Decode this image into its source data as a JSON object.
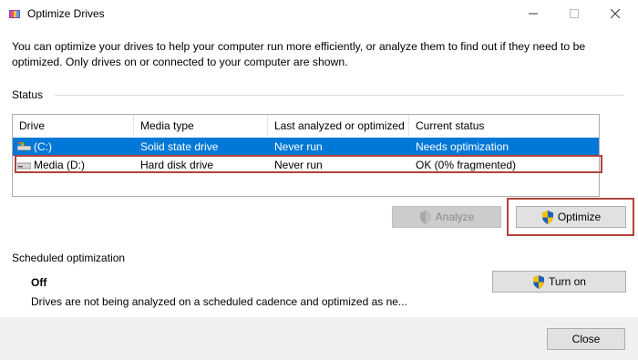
{
  "window": {
    "title": "Optimize Drives",
    "minimize_glyph": "—",
    "maximize_glyph": "☐",
    "close_glyph": "✕"
  },
  "intro_text": "You can optimize your drives to help your computer run more efficiently, or analyze them to find out if they need to be optimized. Only drives on or connected to your computer are shown.",
  "status": {
    "label": "Status",
    "columns": [
      "Drive",
      "Media type",
      "Last analyzed or optimized",
      "Current status"
    ],
    "drives": [
      {
        "drive": "(C:)",
        "media_type": "Solid state drive",
        "last": "Never run",
        "status": "Needs optimization",
        "icon": "windows-drive-icon",
        "selected": true
      },
      {
        "drive": "Media (D:)",
        "media_type": "Hard disk drive",
        "last": "Never run",
        "status": "OK (0% fragmented)",
        "icon": "hard-drive-icon",
        "selected": false
      }
    ]
  },
  "buttons": {
    "analyze": "Analyze",
    "optimize": "Optimize",
    "turn_on": "Turn on",
    "close": "Close"
  },
  "scheduled": {
    "label": "Scheduled optimization",
    "state": "Off",
    "description": "Drives are not being analyzed on a scheduled cadence and optimized as ne..."
  },
  "colors": {
    "selection": "#0078d7",
    "highlight_outline": "#b3433b"
  }
}
